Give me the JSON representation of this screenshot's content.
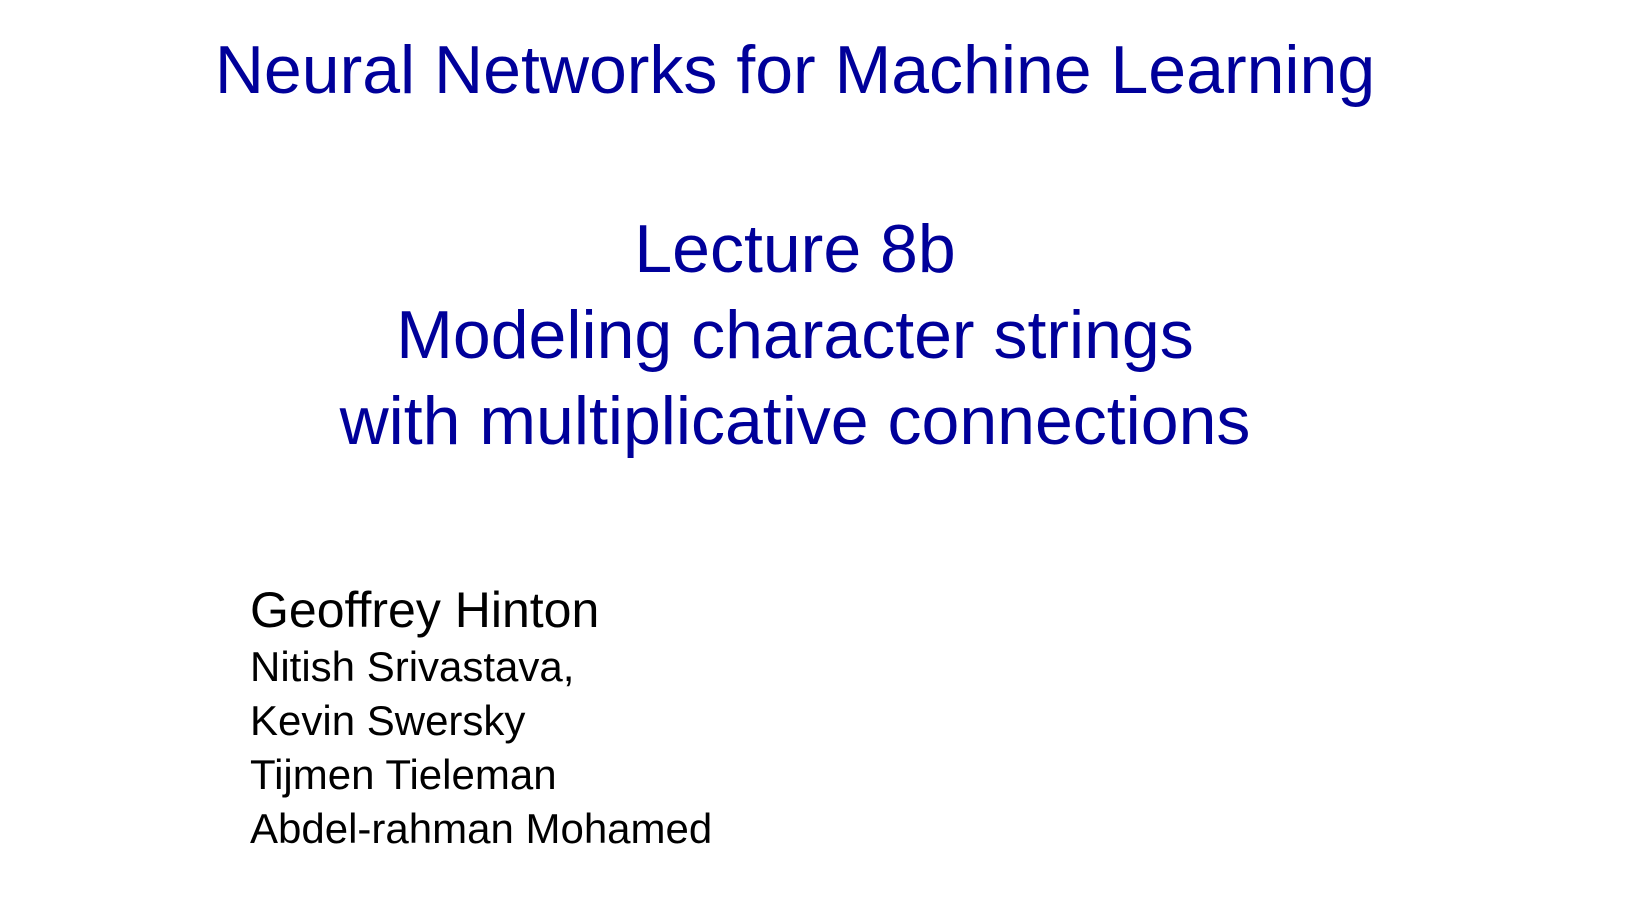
{
  "slide": {
    "course_title": "Neural Networks for Machine Learning",
    "lecture_number": "Lecture 8b",
    "lecture_title_line1": "Modeling character strings",
    "lecture_title_line2": "with multiplicative connections",
    "authors": {
      "main": "Geoffrey Hinton",
      "others": [
        "Nitish Srivastava,",
        "Kevin Swersky",
        "Tijmen Tieleman",
        "Abdel-rahman Mohamed"
      ]
    },
    "colors": {
      "title": "#00009a",
      "authors": "#000000",
      "background": "#ffffff"
    }
  }
}
